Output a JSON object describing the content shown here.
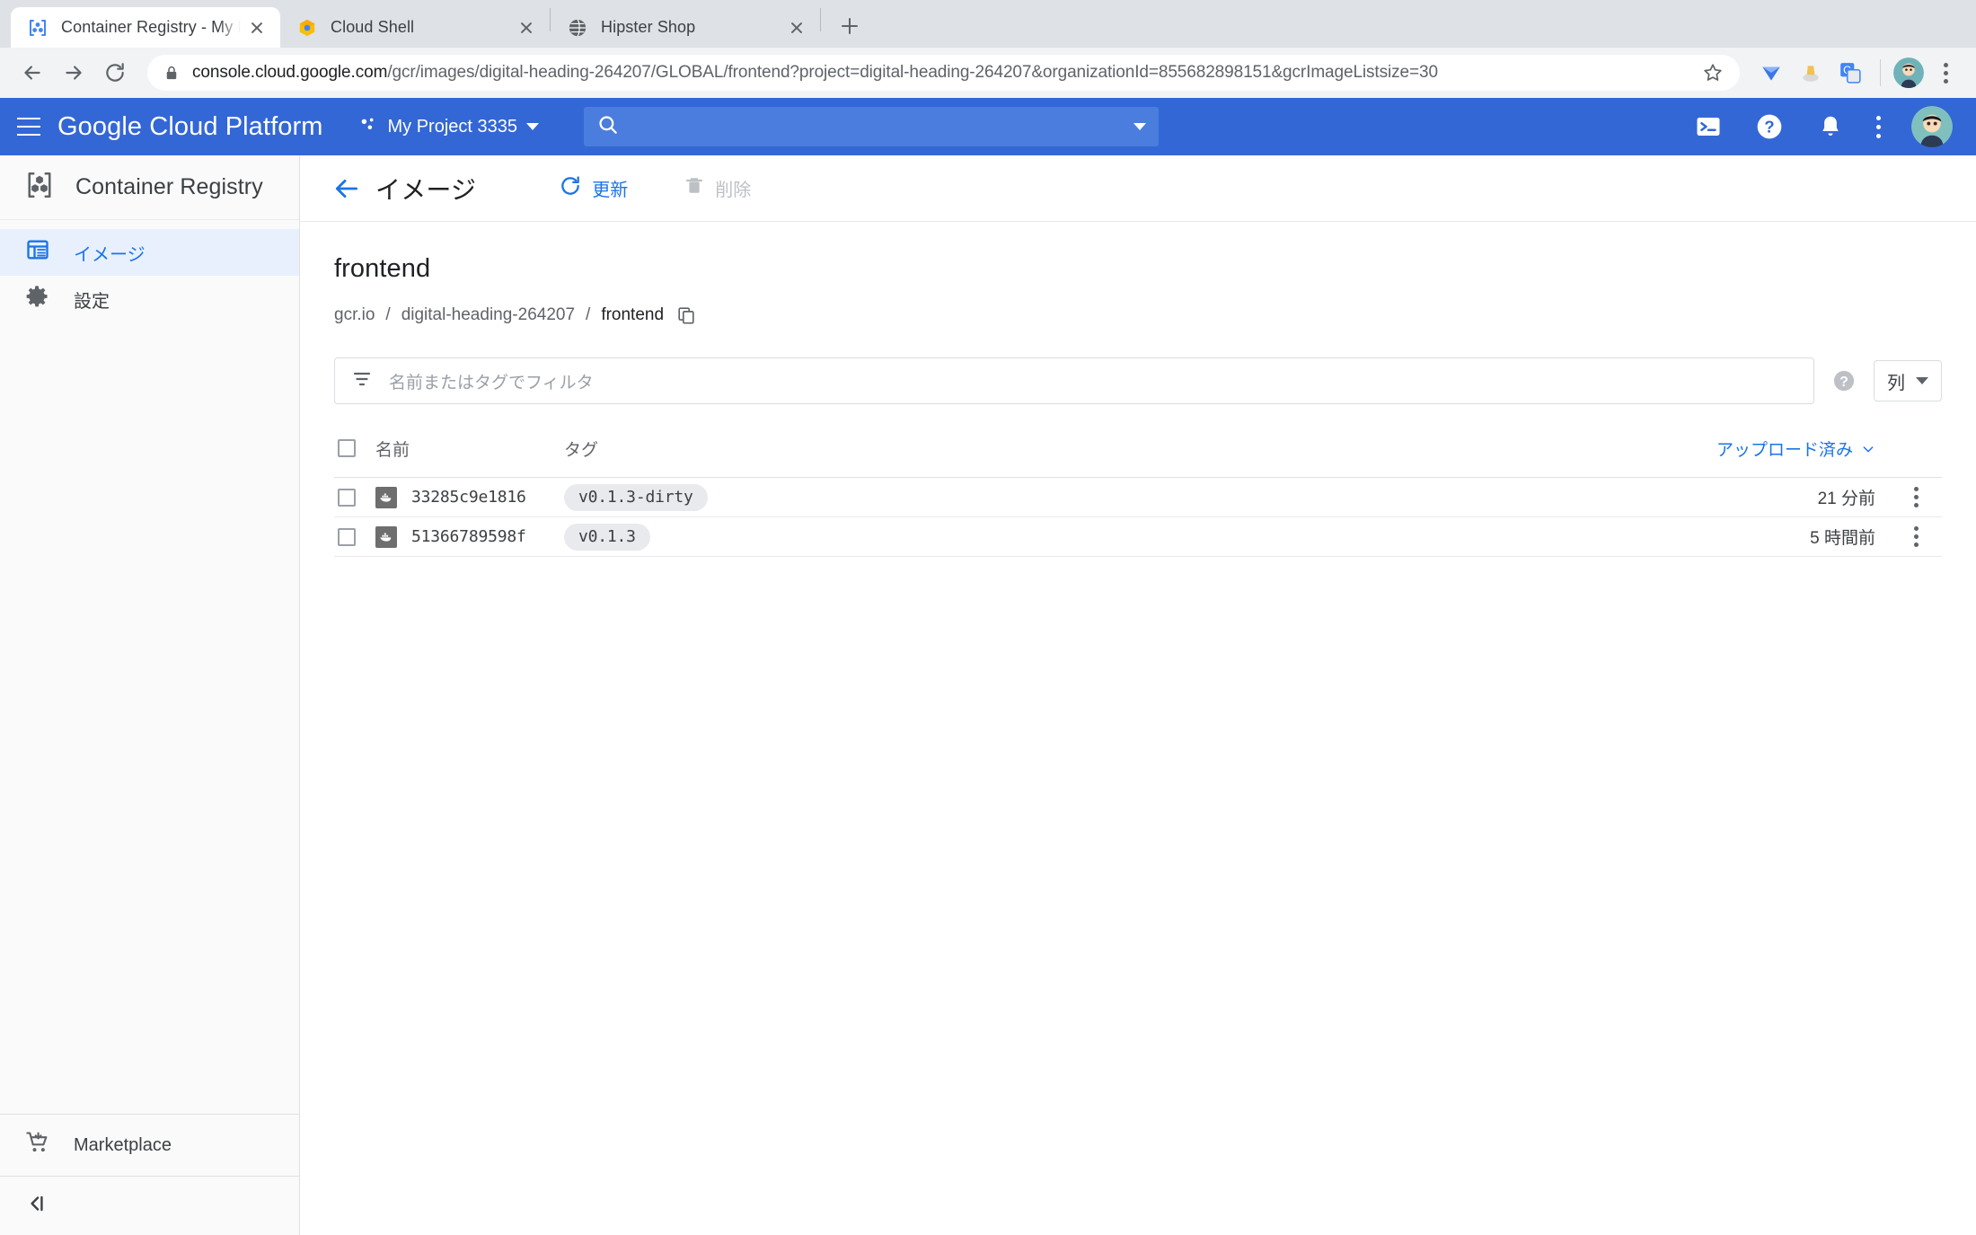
{
  "browser": {
    "tabs": [
      {
        "title": "Container Registry - My Projec",
        "favicon": "container-registry-icon",
        "active": true
      },
      {
        "title": "Cloud Shell",
        "favicon": "cloud-shell-icon",
        "active": false
      },
      {
        "title": "Hipster Shop",
        "favicon": "globe-icon",
        "active": false
      }
    ],
    "new_tab_label": "+",
    "nav": {
      "back": "back-arrow-icon",
      "forward": "forward-arrow-icon",
      "reload": "reload-icon"
    },
    "omnibox": {
      "lock": "lock-icon",
      "url_host": "console.cloud.google.com",
      "url_path": "/gcr/images/digital-heading-264207/GLOBAL/frontend?project=digital-heading-264207&organizationId=855682898151&gcrImageListsize=30",
      "star": "bookmark-star-icon"
    },
    "extensions": [
      "diamond-extension-icon",
      "honey-extension-icon",
      "google-translate-icon"
    ],
    "profile": "profile-avatar",
    "menu": "chrome-menu-icon"
  },
  "gcp_header": {
    "menu_icon": "hamburger-menu-icon",
    "brand": "Google Cloud Platform",
    "project_icon": "project-selector-icon",
    "project_name": "My Project 3335",
    "search_icon": "search-icon",
    "search_placeholder": "",
    "icons": [
      "cloud-shell-icon",
      "help-icon",
      "notifications-bell-icon",
      "more-options-icon"
    ],
    "avatar": "user-avatar",
    "bg_color": "#3367d6"
  },
  "sidebar": {
    "product_icon": "container-registry-icon",
    "product_name": "Container Registry",
    "items": [
      {
        "label": "イメージ",
        "icon": "list-images-icon",
        "active": true
      },
      {
        "label": "設定",
        "icon": "settings-gear-icon",
        "active": false
      }
    ],
    "marketplace": {
      "label": "Marketplace",
      "icon": "shopping-cart-icon"
    },
    "collapse_icon": "collapse-panel-icon",
    "active_color": "#1a73e8"
  },
  "page": {
    "back_icon": "back-arrow-icon",
    "title": "イメージ",
    "actions": [
      {
        "label": "更新",
        "icon": "refresh-icon",
        "enabled": true
      },
      {
        "label": "削除",
        "icon": "trash-delete-icon",
        "enabled": false
      }
    ]
  },
  "resource": {
    "name": "frontend",
    "path_registry": "gcr.io",
    "path_project": "digital-heading-264207",
    "path_image": "frontend",
    "path_sep": "/",
    "copy_icon": "copy-to-clipboard-icon"
  },
  "filter": {
    "icon": "filter-icon",
    "placeholder": "名前またはタグでフィルタ",
    "value": "",
    "help_icon": "help-circle-icon",
    "columns_label": "列",
    "columns_caret": "chevron-down-icon"
  },
  "table": {
    "columns": {
      "select_all": "select-all-checkbox",
      "name": "名前",
      "tag": "タグ",
      "uploaded": "アップロード済み",
      "sort_caret": "chevron-down-icon"
    },
    "rows": [
      {
        "checkbox": "row-checkbox",
        "icon": "docker-image-icon",
        "digest": "33285c9e1816",
        "tags": [
          "v0.1.3-dirty"
        ],
        "uploaded": "21 分前",
        "menu": "row-overflow-menu"
      },
      {
        "checkbox": "row-checkbox",
        "icon": "docker-image-icon",
        "digest": "51366789598f",
        "tags": [
          "v0.1.3"
        ],
        "uploaded": "5 時間前",
        "menu": "row-overflow-menu"
      }
    ]
  }
}
